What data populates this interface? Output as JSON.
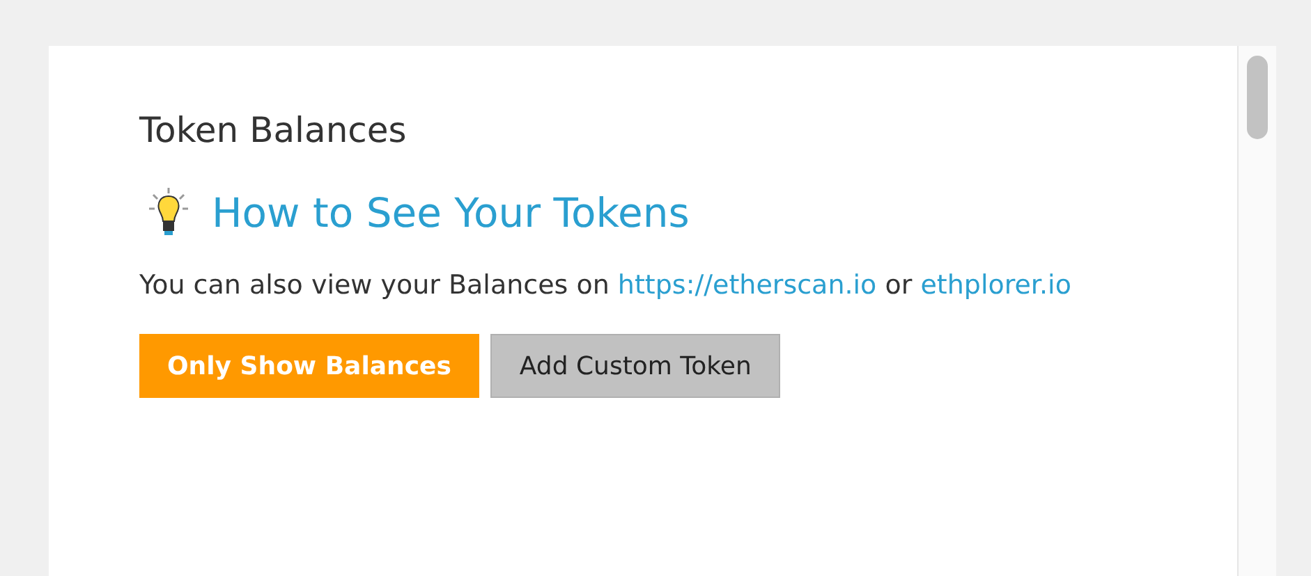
{
  "title": "Token Balances",
  "help_link": "How to See Your Tokens",
  "description": {
    "text": "You can also view your Balances on",
    "links": [
      "https://etherscan.io",
      "ethplorer.io"
    ],
    "joiner": "or"
  },
  "buttons": [
    {
      "label": "Only Show Balances",
      "kind": "primary"
    },
    {
      "label": "Add Custom Token",
      "kind": "secondary"
    }
  ]
}
